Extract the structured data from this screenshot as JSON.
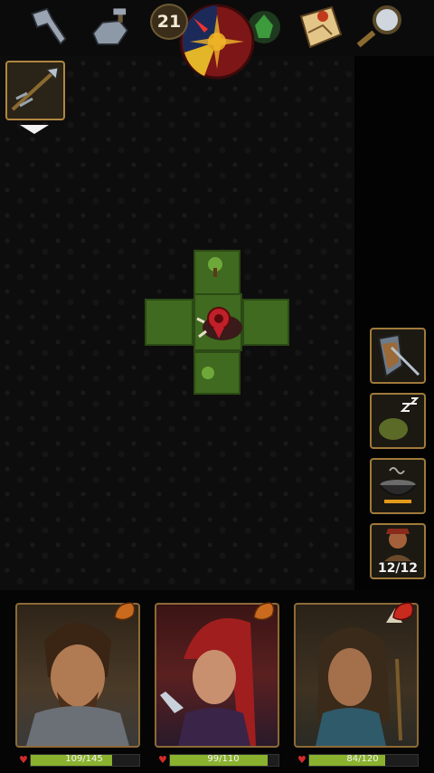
{
  "topbar": {
    "icons": [
      {
        "name": "axe-icon"
      },
      {
        "name": "anvil-icon"
      },
      {
        "name": "goblin-head-icon"
      },
      {
        "name": "map-scroll-icon"
      },
      {
        "name": "magnifier-icon"
      }
    ],
    "turn_counter": "21"
  },
  "equipped_item": {
    "icon": "spear-icon"
  },
  "actions": [
    {
      "name": "defend-action-button",
      "icon": "shield-sword-icon"
    },
    {
      "name": "rest-action-button",
      "icon": "sleeping-goblin-icon"
    },
    {
      "name": "cook-action-button",
      "icon": "cauldron-icon"
    },
    {
      "name": "party-button",
      "icon": "party-member-icon",
      "label": "12/12"
    }
  ],
  "party": [
    {
      "name": "warrior",
      "hp_text": "109/145",
      "hp_fraction": 0.75
    },
    {
      "name": "rogue",
      "hp_text": "99/110",
      "hp_fraction": 0.9
    },
    {
      "name": "shaman",
      "hp_text": "84/120",
      "hp_fraction": 0.7
    }
  ],
  "colors": {
    "accent": "#a07a3a",
    "health": "#8ab22e",
    "grass": "#3f6a1f"
  }
}
